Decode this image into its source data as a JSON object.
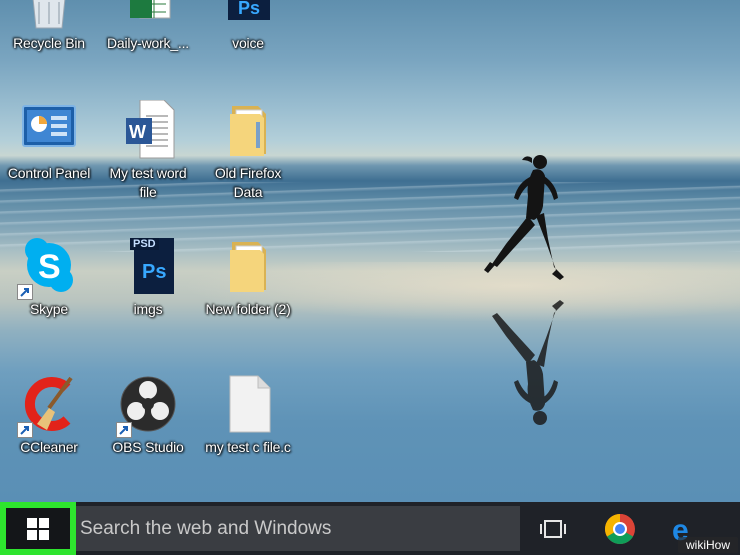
{
  "desktop": {
    "icons": [
      {
        "label": "Recycle Bin",
        "icon": "recycle-bin-icon"
      },
      {
        "label": "Daily-work_...",
        "icon": "excel-file-icon"
      },
      {
        "label": "voice",
        "icon": "photoshop-file-icon"
      },
      {
        "label": "Control Panel",
        "icon": "control-panel-icon"
      },
      {
        "label": "My test word file",
        "icon": "word-file-icon"
      },
      {
        "label": "Old Firefox Data",
        "icon": "folder-icon"
      },
      {
        "label": "Skype",
        "icon": "skype-icon"
      },
      {
        "label": "imgs",
        "icon": "photoshop-file-icon",
        "badge": "PSD"
      },
      {
        "label": "New folder (2)",
        "icon": "folder-icon"
      },
      {
        "label": "CCleaner",
        "icon": "ccleaner-icon"
      },
      {
        "label": "OBS Studio",
        "icon": "obs-studio-icon"
      },
      {
        "label": "my test c file.c",
        "icon": "blank-file-icon"
      }
    ]
  },
  "taskbar": {
    "start_icon": "windows-logo-icon",
    "search_placeholder": "Search the web and Windows",
    "buttons": [
      "task-view-icon",
      "chrome-icon",
      "edge-icon"
    ],
    "highlight_color": "#2ee42e"
  },
  "watermark": {
    "prefix": "wiki",
    "suffix": "How"
  }
}
